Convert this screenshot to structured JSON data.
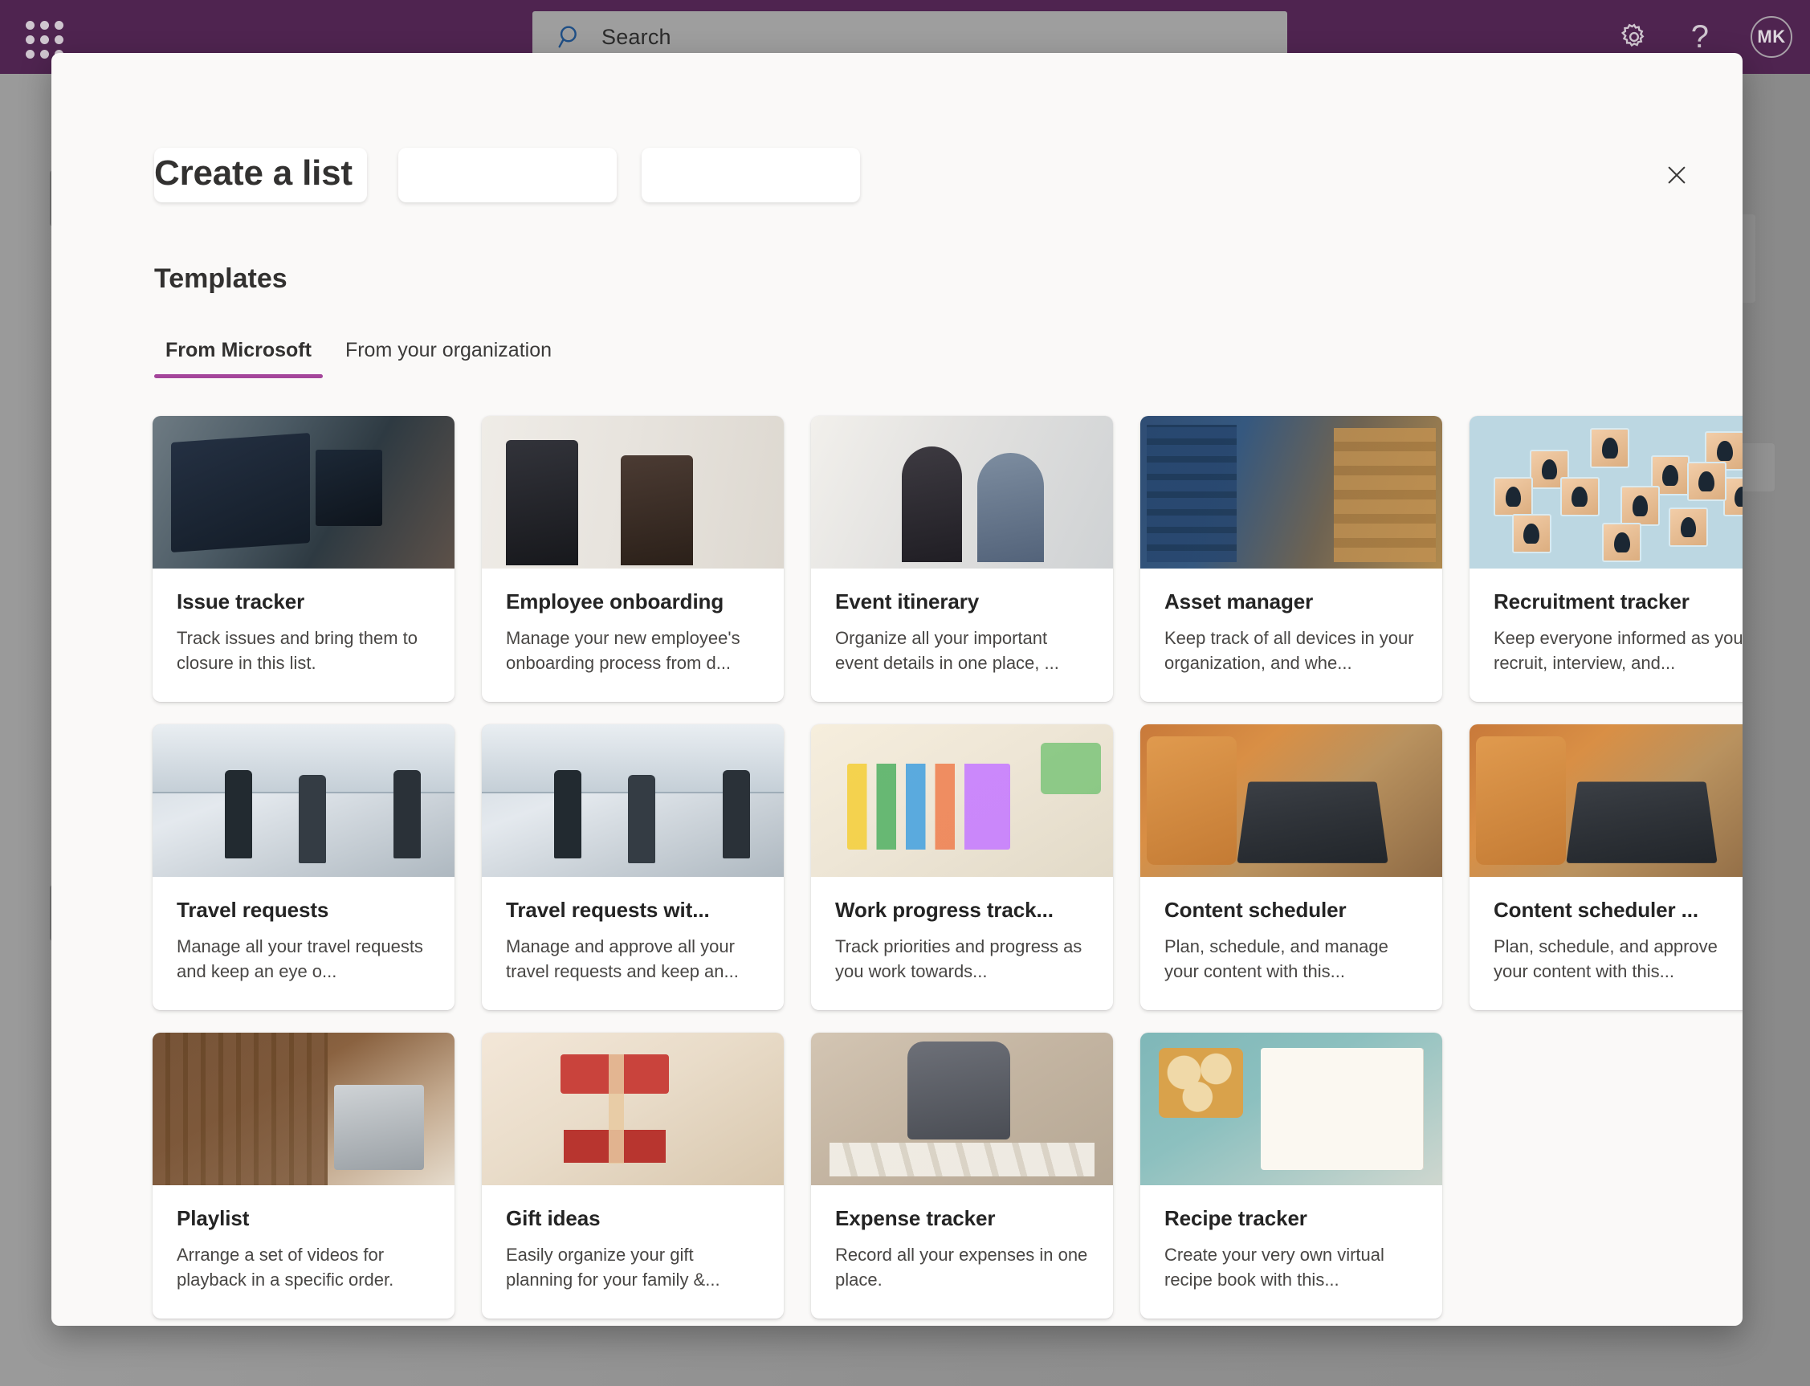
{
  "suite_bar": {
    "waffle_label": "App launcher",
    "search": {
      "placeholder": "Search",
      "value": ""
    },
    "settings_label": "Settings",
    "help_label": "?",
    "avatar_initials": "MK"
  },
  "dialog": {
    "title": "Create a list",
    "close_label": "Close",
    "templates_heading": "Templates",
    "tabs": [
      {
        "label": "From Microsoft",
        "active": true
      },
      {
        "label": "From your organization",
        "active": false
      }
    ]
  },
  "templates": [
    {
      "title": "Issue tracker",
      "desc": "Track issues and bring them to closure in this list.",
      "thumb": "th-issue"
    },
    {
      "title": "Employee onboarding",
      "desc": "Manage your new employee's onboarding process from d...",
      "thumb": "th-onboard"
    },
    {
      "title": "Event itinerary",
      "desc": "Organize all your important event details in one place, ...",
      "thumb": "th-event"
    },
    {
      "title": "Asset manager",
      "desc": "Keep track of all devices in your organization, and whe...",
      "thumb": "th-asset"
    },
    {
      "title": "Recruitment tracker",
      "desc": "Keep everyone informed as you recruit, interview, and...",
      "thumb": "th-recruit"
    },
    {
      "title": "Travel requests",
      "desc": "Manage all your travel requests and keep an eye o...",
      "thumb": "th-travel"
    },
    {
      "title": "Travel requests wit...",
      "desc": "Manage and approve all your travel requests and keep an...",
      "thumb": "th-travel"
    },
    {
      "title": "Work progress track...",
      "desc": "Track priorities and progress as you work towards...",
      "thumb": "th-work"
    },
    {
      "title": "Content scheduler",
      "desc": "Plan, schedule, and manage your content with this...",
      "thumb": "th-content"
    },
    {
      "title": "Content scheduler ...",
      "desc": "Plan, schedule, and approve your content with this...",
      "thumb": "th-content"
    },
    {
      "title": "Playlist",
      "desc": "Arrange a set of videos for playback in a specific order.",
      "thumb": "th-playlist"
    },
    {
      "title": "Gift ideas",
      "desc": "Easily organize your gift planning for your family &...",
      "thumb": "th-gift"
    },
    {
      "title": "Expense tracker",
      "desc": "Record all your expenses in one place.",
      "thumb": "th-expense"
    },
    {
      "title": "Recipe tracker",
      "desc": "Create your very own virtual recipe book with this...",
      "thumb": "th-recipe"
    }
  ],
  "colors": {
    "suite_bar": "#4F2450",
    "accent": "#A4469B",
    "dialog_bg": "#faf9f8",
    "card_bg": "#ffffff",
    "title_text": "#323130",
    "body_text": "#484644"
  }
}
